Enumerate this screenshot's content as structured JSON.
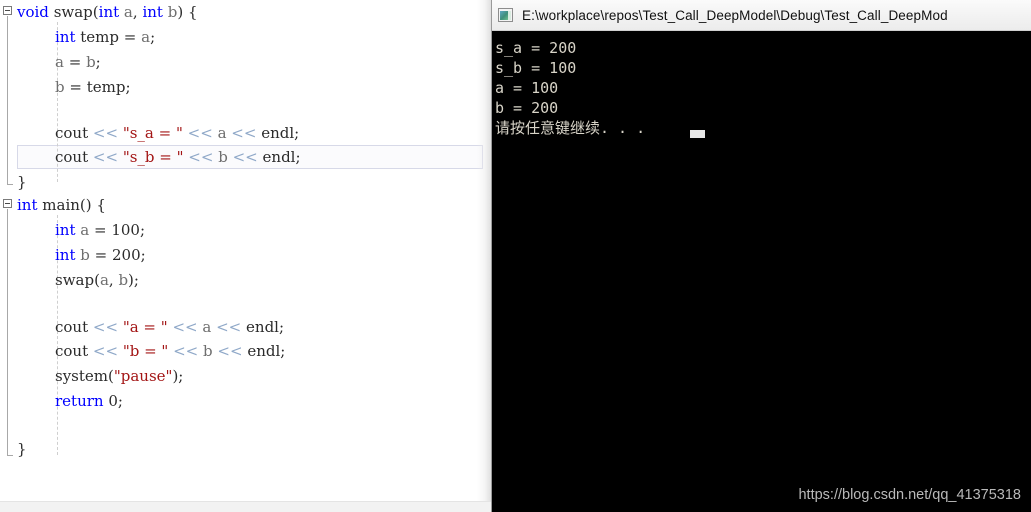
{
  "editor": {
    "name": "code-editor-pane",
    "language": "C++",
    "current_line_index": 6,
    "colors": {
      "background": "#ffffff",
      "keyword": "#0000ff",
      "string": "#a31515",
      "operator": "#8fa8c8",
      "identifier": "#2b2b2b",
      "variable": "#6f6f6f",
      "current_line_border": "#d7d9e8",
      "indent_guide": "#cfcfcf",
      "outline_line": "#a8a8a8"
    },
    "lines": [
      {
        "indent": 0,
        "text": "void swap(int a, int b) {"
      },
      {
        "indent": 1,
        "text": "int temp = a;"
      },
      {
        "indent": 1,
        "text": "a = b;"
      },
      {
        "indent": 1,
        "text": "b = temp;"
      },
      {
        "indent": 1,
        "text": ""
      },
      {
        "indent": 1,
        "text": "cout << \"s_a = \" << a << endl;"
      },
      {
        "indent": 1,
        "text": "cout << \"s_b = \" << b << endl;"
      },
      {
        "indent": 0,
        "text": "}"
      },
      {
        "indent": 0,
        "text": "int main() {"
      },
      {
        "indent": 1,
        "text": "int a = 100;"
      },
      {
        "indent": 1,
        "text": "int b = 200;"
      },
      {
        "indent": 1,
        "text": "swap(a, b);"
      },
      {
        "indent": 1,
        "text": ""
      },
      {
        "indent": 1,
        "text": "cout << \"a = \" << a << endl;"
      },
      {
        "indent": 1,
        "text": "cout << \"b = \" << b << endl;"
      },
      {
        "indent": 1,
        "text": "system(\"pause\");"
      },
      {
        "indent": 1,
        "text": "return 0;"
      },
      {
        "indent": 1,
        "text": ""
      },
      {
        "indent": 0,
        "text": "}"
      }
    ],
    "fold_markers": [
      {
        "label": "-",
        "line": 0
      },
      {
        "label": "-",
        "line": 8
      }
    ]
  },
  "console": {
    "icon": "console-window-icon",
    "title": "E:\\workplace\\repos\\Test_Call_DeepModel\\Debug\\Test_Call_DeepMod",
    "background": "#000000",
    "text_color": "#d8d4c8",
    "output_lines": [
      "s_a = 200",
      "s_b = 100",
      "a = 100",
      "b = 200",
      "请按任意键继续. . .  "
    ],
    "cursor": "block-cursor"
  },
  "watermark": {
    "text": "https://blog.csdn.net/qq_41375318"
  }
}
